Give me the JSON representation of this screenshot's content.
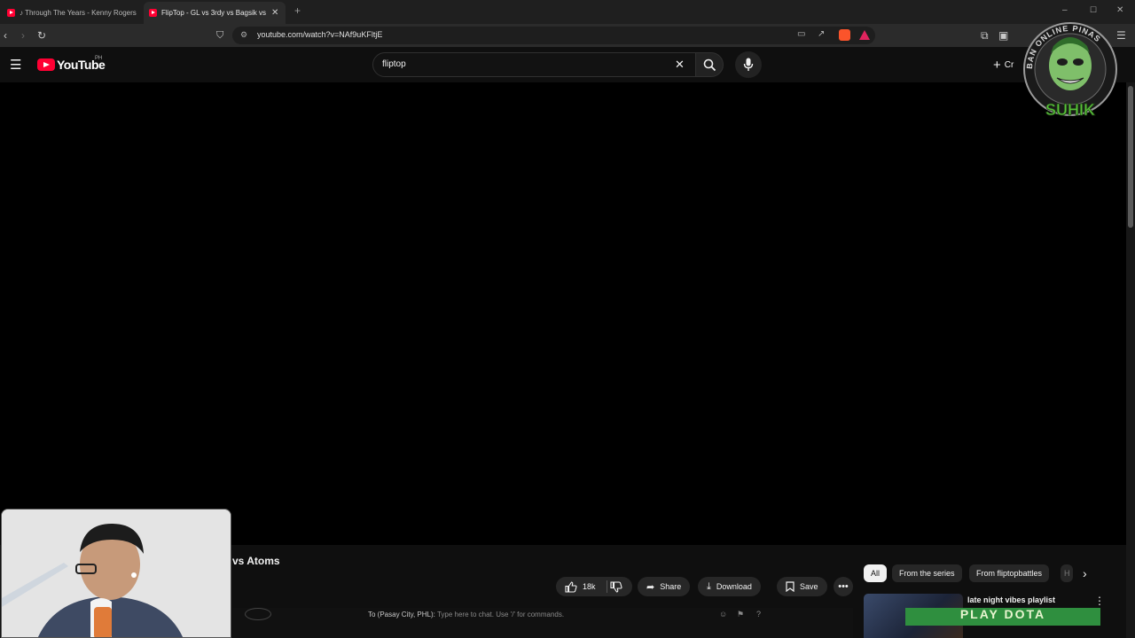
{
  "browser": {
    "tabs": [
      {
        "label": "♪ Through The Years - Kenny Rogers",
        "active": false
      },
      {
        "label": "FlipTop - GL vs 3rdy vs Bagsik vs",
        "active": true
      }
    ],
    "new_tab_glyph": "+",
    "address": "youtube.com/watch?v=NAf9uKFltjE"
  },
  "youtube": {
    "logo_text": "YouTube",
    "country_code": "PH",
    "search_value": "fliptop",
    "create_label": "Cr"
  },
  "video": {
    "title_fragment": "vs Atoms",
    "like_count": "18k",
    "share_label": "Share",
    "download_label": "Download",
    "save_label": "Save"
  },
  "chips": [
    {
      "label": "All",
      "active": true
    },
    {
      "label": "From the series",
      "active": false
    },
    {
      "label": "From fliptopbattles",
      "active": false
    },
    {
      "label": "H",
      "active": false
    }
  ],
  "recommendation": {
    "title": "late night vibes playlist",
    "overlay_text": "PLAY DOTA"
  },
  "chat_overlay": {
    "prefix": "To (Pasay City, PHL):",
    "placeholder": "Type here to chat. Use '/' for commands."
  },
  "watermark": {
    "ring_text": "BAN ONLINE PINAS",
    "brand_text": "SUHIK"
  },
  "colors": {
    "youtube_red": "#ff0033",
    "page_bg": "#0f0f0f",
    "chip_active_bg": "#f1f1f1",
    "dota_green": "#2f8f3f"
  }
}
